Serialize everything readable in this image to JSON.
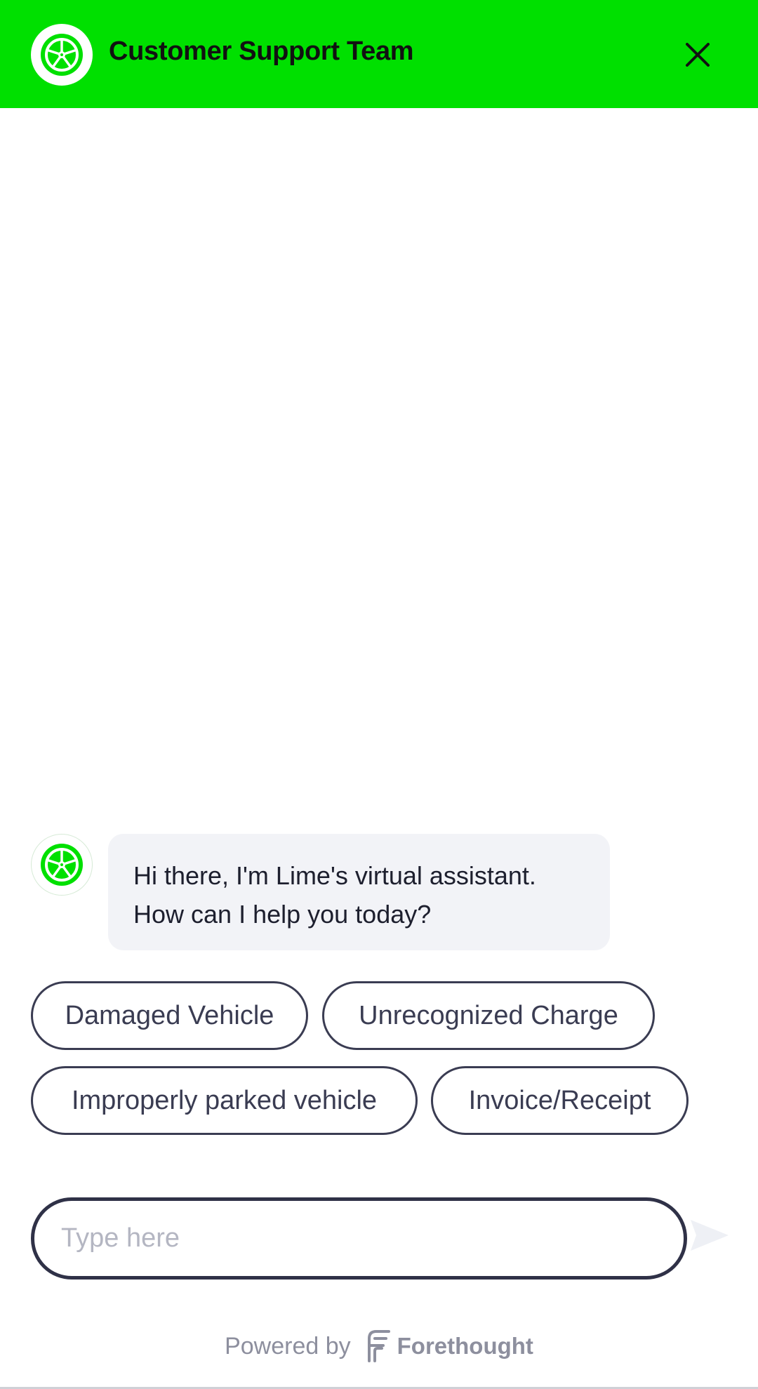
{
  "header": {
    "title": "Customer Support Team",
    "brand_color": "#00e000",
    "logo_icon": "lime-wheel-icon",
    "close_icon": "close-icon"
  },
  "conversation": {
    "messages": [
      {
        "sender": "bot",
        "avatar_icon": "lime-wheel-icon",
        "lines": [
          "Hi there, I'm Lime's virtual assistant.",
          "How can I help you today?"
        ]
      }
    ],
    "quick_replies": [
      "Damaged Vehicle",
      "Unrecognized Charge",
      "Improperly parked vehicle",
      "Invoice/Receipt"
    ]
  },
  "composer": {
    "value": "",
    "placeholder": "Type here",
    "send_icon": "send-icon"
  },
  "footer": {
    "powered_by": "Powered by",
    "brand": "Forethought"
  }
}
